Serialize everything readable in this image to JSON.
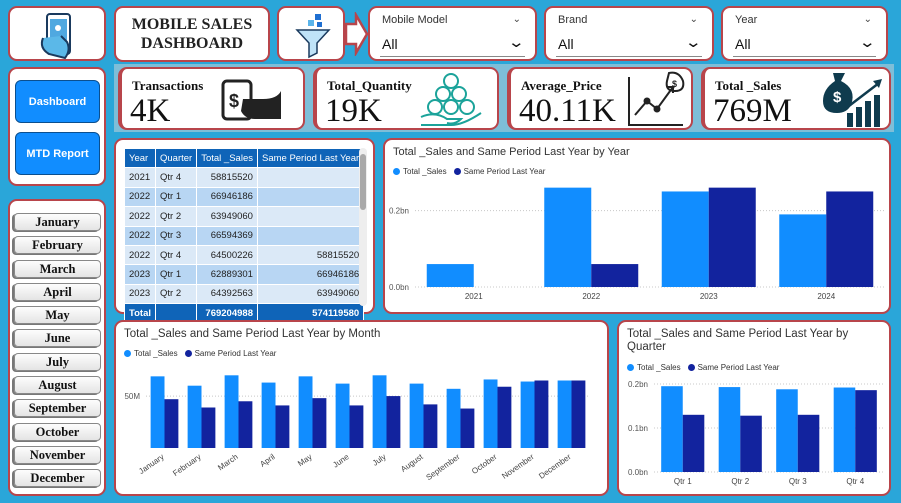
{
  "header": {
    "title_line1": "MOBILE SALES",
    "title_line2": "DASHBOARD"
  },
  "filters": [
    {
      "label": "Mobile Model",
      "value": "All"
    },
    {
      "label": "Brand",
      "value": "All"
    },
    {
      "label": "Year",
      "value": "All"
    }
  ],
  "kpis": [
    {
      "title": "Transactions",
      "value": "4K",
      "icon": "hand-card-icon"
    },
    {
      "title": "Total_Quantity",
      "value": "19K",
      "icon": "coins-hand-icon"
    },
    {
      "title": "Average_Price",
      "value": "40.11K",
      "icon": "growth-chart-icon"
    },
    {
      "title": "Total _Sales",
      "value": "769M",
      "icon": "money-bag-growth-icon"
    }
  ],
  "nav": {
    "dashboard": "Dashboard",
    "mtd": "MTD Report"
  },
  "months": [
    "January",
    "February",
    "March",
    "April",
    "May",
    "June",
    "July",
    "August",
    "September",
    "October",
    "November",
    "December"
  ],
  "colors": {
    "accent": "#118dff",
    "series2": "#12239e",
    "border": "#b8454b",
    "background": "#2aa6d9",
    "table_header": "#0f64b8"
  },
  "table": {
    "headers": [
      "Year",
      "Quarter",
      "Total _Sales",
      "Same Period Last Year"
    ],
    "rows": [
      [
        "2021",
        "Qtr 4",
        "58815520",
        ""
      ],
      [
        "2022",
        "Qtr 1",
        "66946186",
        ""
      ],
      [
        "2022",
        "Qtr 2",
        "63949060",
        ""
      ],
      [
        "2022",
        "Qtr 3",
        "66594369",
        ""
      ],
      [
        "2022",
        "Qtr 4",
        "64500226",
        "58815520"
      ],
      [
        "2023",
        "Qtr 1",
        "62889301",
        "66946186"
      ],
      [
        "2023",
        "Qtr 2",
        "64392563",
        "63949060"
      ]
    ],
    "total": [
      "Total",
      "",
      "769204988",
      "574119580"
    ]
  },
  "chart_data": [
    {
      "type": "bar",
      "title": "Total _Sales and Same Period Last Year by Year",
      "categories": [
        "2021",
        "2022",
        "2023",
        "2024"
      ],
      "series": [
        {
          "name": "Total _Sales",
          "values": [
            0.06,
            0.26,
            0.25,
            0.19
          ]
        },
        {
          "name": "Same Period Last Year",
          "values": [
            0,
            0.06,
            0.26,
            0.25
          ]
        }
      ],
      "ytick_labels": [
        "0.0bn",
        "0.2bn"
      ],
      "yticks": [
        0,
        0.2
      ],
      "ylim": [
        0,
        0.28
      ],
      "legend": "top-left"
    },
    {
      "type": "bar",
      "title": "Total _Sales and Same Period Last Year by Month",
      "categories": [
        "January",
        "February",
        "March",
        "April",
        "May",
        "June",
        "July",
        "August",
        "September",
        "October",
        "November",
        "December"
      ],
      "series": [
        {
          "name": "Total _Sales",
          "values": [
            69,
            60,
            70,
            63,
            69,
            62,
            70,
            62,
            57,
            66,
            64,
            65
          ]
        },
        {
          "name": "Same Period Last Year",
          "values": [
            47,
            39,
            45,
            41,
            48,
            41,
            50,
            42,
            38,
            59,
            65,
            65
          ]
        }
      ],
      "ytick_labels": [
        "50M"
      ],
      "yticks": [
        50
      ],
      "ylim": [
        0,
        78
      ],
      "legend": "top-left"
    },
    {
      "type": "bar",
      "title": "Total _Sales and Same Period Last Year by Quarter",
      "categories": [
        "Qtr 1",
        "Qtr 2",
        "Qtr 3",
        "Qtr 4"
      ],
      "series": [
        {
          "name": "Total _Sales",
          "values": [
            0.195,
            0.193,
            0.188,
            0.192
          ]
        },
        {
          "name": "Same Period Last Year",
          "values": [
            0.13,
            0.128,
            0.13,
            0.186
          ]
        }
      ],
      "ytick_labels": [
        "0.0bn",
        "0.1bn",
        "0.2bn"
      ],
      "yticks": [
        0,
        0.1,
        0.2
      ],
      "ylim": [
        0,
        0.2
      ],
      "legend": "top-left"
    }
  ]
}
